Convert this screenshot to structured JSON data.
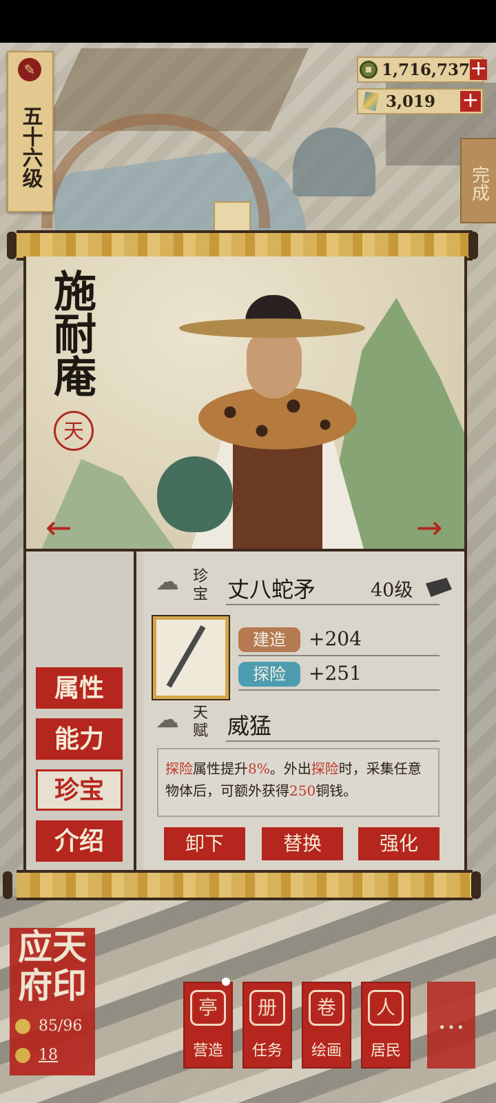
{
  "level": {
    "text": "五十六级"
  },
  "currencies": [
    {
      "icon": "copper-coin-icon",
      "value": "1,716,737"
    },
    {
      "icon": "jade-icon",
      "value": "3,019"
    }
  ],
  "side_tab": {
    "label": "完成"
  },
  "character": {
    "name": "施耐庵",
    "seal": "天"
  },
  "tabs": [
    "属性",
    "能力",
    "珍宝",
    "介绍"
  ],
  "active_tab": "珍宝",
  "treasure": {
    "section_label": "珍宝",
    "name": "丈八蛇矛",
    "level": "40级",
    "stats": [
      {
        "label": "建造",
        "value": "+204",
        "color": "#b57a52"
      },
      {
        "label": "探险",
        "value": "+251",
        "color": "#4d9cb0"
      }
    ]
  },
  "talent": {
    "section_label": "天赋",
    "name": "威猛",
    "desc_parts": [
      {
        "text": "探险",
        "hl": true
      },
      {
        "text": "属性提升",
        "hl": false
      },
      {
        "text": "8%",
        "hl": true
      },
      {
        "text": "。外出",
        "hl": false
      },
      {
        "text": "探险",
        "hl": true
      },
      {
        "text": "时，采集任意物体后，可额外获得",
        "hl": false
      },
      {
        "text": "250",
        "hl": true
      },
      {
        "text": "铜钱。",
        "hl": false
      }
    ]
  },
  "actions": [
    "卸下",
    "替换",
    "强化"
  ],
  "city": {
    "name": "应天府印",
    "population": "85/96",
    "count": "18"
  },
  "nav": [
    {
      "label": "营造",
      "icon": "build-icon"
    },
    {
      "label": "任务",
      "icon": "task-icon"
    },
    {
      "label": "绘画",
      "icon": "painting-icon"
    },
    {
      "label": "居民",
      "icon": "residents-icon"
    }
  ],
  "more_label": "…"
}
